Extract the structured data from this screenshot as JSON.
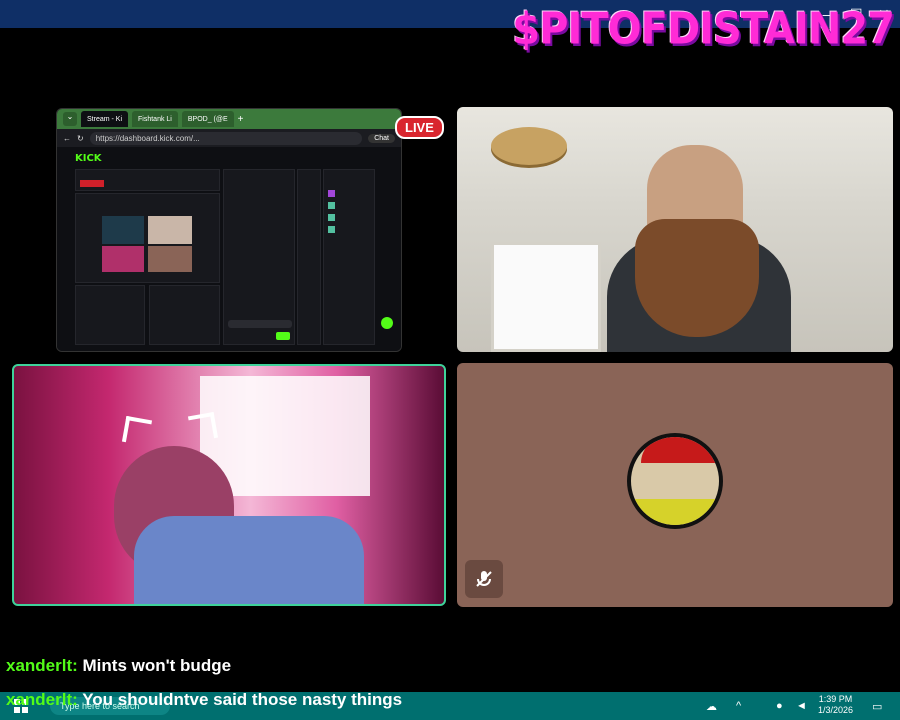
{
  "window": {
    "controls": [
      "—",
      "☐",
      "✕"
    ]
  },
  "overlay": {
    "channel_name": "$PITOFDISTAIN27"
  },
  "live_badge": "LIVE",
  "browser": {
    "tabs": [
      "Stream - Ki",
      "Fishtank Li",
      "BPOD_ (@E"
    ],
    "url": "https://dashboard.kick.com/...",
    "chat_button": "Chat",
    "kick_logo": "KICK"
  },
  "subtitles": [
    {
      "user": "xanderlt:",
      "text": " Mints won't budge"
    },
    {
      "user": "xanderlt:",
      "text": " You shouldntve said those nasty things"
    }
  ],
  "taskbar": {
    "search_placeholder": "Type here to search",
    "time": "1:39 PM",
    "date": "1/3/2026"
  },
  "colors": {
    "kick_green": "#53fc18",
    "overlay_pink": "#ff2bd6",
    "taskbar": "#006f6f",
    "highlight_border": "#3fd29a"
  }
}
